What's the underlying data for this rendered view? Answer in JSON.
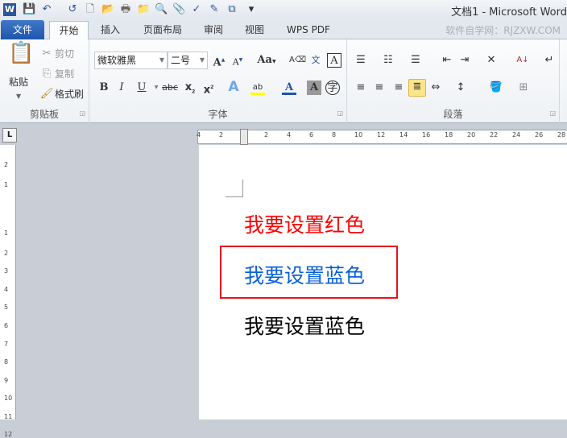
{
  "titlebar": {
    "title": "文档1 - Microsoft Word",
    "quick_access": [
      "word-logo",
      "save",
      "undo",
      "redo",
      "new",
      "open",
      "print",
      "folder",
      "print-preview",
      "attach",
      "spell-check",
      "edit-table",
      "diagram",
      "customize"
    ]
  },
  "tabs": {
    "file": "文件",
    "items": [
      "开始",
      "插入",
      "页面布局",
      "审阅",
      "视图",
      "WPS PDF"
    ],
    "watermark": "软件自学网：RJZXW.COM"
  },
  "ribbon": {
    "clipboard": {
      "label": "剪贴板",
      "paste": "粘贴",
      "cut": "剪切",
      "copy": "复制",
      "format_painter": "格式刷"
    },
    "font": {
      "label": "字体",
      "font_name": "微软雅黑",
      "font_size": "二号"
    },
    "paragraph": {
      "label": "段落"
    }
  },
  "ruler": {
    "h_labels": [
      "4",
      "2",
      "2",
      "4",
      "6",
      "8",
      "10",
      "12",
      "14",
      "16",
      "18",
      "20",
      "22",
      "24",
      "26",
      "28"
    ],
    "v_labels": [
      "2",
      "1",
      "1",
      "2",
      "3",
      "4",
      "5",
      "6",
      "7",
      "8",
      "9",
      "10",
      "11",
      "12"
    ]
  },
  "document": {
    "lines": [
      {
        "text": "我要设置红色",
        "color": "#ff0000"
      },
      {
        "text": "我要设置蓝色",
        "color": "#0a5fd8"
      },
      {
        "text": "我要设置蓝色",
        "color": "#000000"
      }
    ],
    "highlight_color": "#e8141c"
  }
}
